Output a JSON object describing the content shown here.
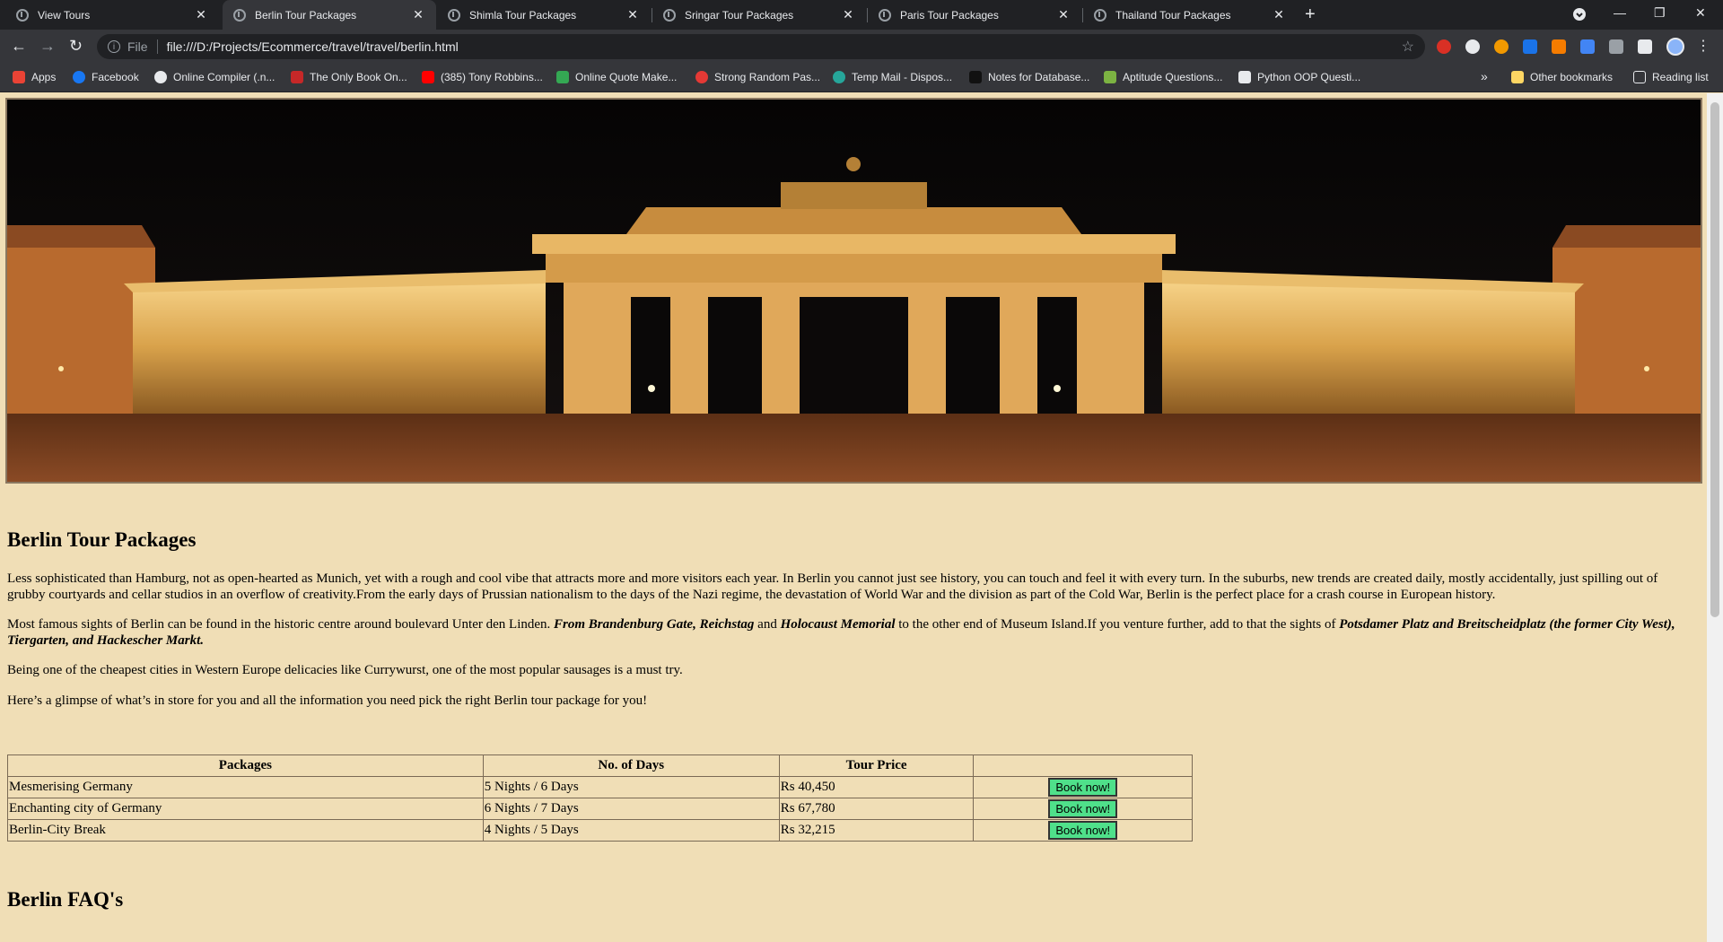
{
  "browser": {
    "tabs": [
      {
        "title": "View Tours",
        "active": false
      },
      {
        "title": "Berlin Tour Packages",
        "active": true
      },
      {
        "title": "Shimla Tour Packages",
        "active": false
      },
      {
        "title": "Sringar Tour Packages",
        "active": false
      },
      {
        "title": "Paris Tour Packages",
        "active": false
      },
      {
        "title": "Thailand Tour Packages",
        "active": false
      }
    ],
    "address": {
      "chip": "File",
      "url": "file:///D:/Projects/Ecommerce/travel/travel/berlin.html"
    },
    "bookmarks": [
      {
        "label": "Apps",
        "icon": "apps-grid-icon",
        "color": "#ea4335"
      },
      {
        "label": "Facebook",
        "icon": "facebook-icon",
        "color": "#1877f2"
      },
      {
        "label": "Online Compiler (.n...",
        "icon": "compiler-icon",
        "color": "#e8eaed"
      },
      {
        "label": "The Only Book On...",
        "icon": "book-icon",
        "color": "#c62828"
      },
      {
        "label": "(385) Tony Robbins...",
        "icon": "youtube-icon",
        "color": "#ff0000"
      },
      {
        "label": "Online Quote Make...",
        "icon": "quote-icon",
        "color": "#34a853"
      },
      {
        "label": "Strong Random Pas...",
        "icon": "password-icon",
        "color": "#e53935"
      },
      {
        "label": "Temp Mail - Dispos...",
        "icon": "tempmail-icon",
        "color": "#26a69a"
      },
      {
        "label": "Notes for Database...",
        "icon": "notes-icon",
        "color": "#111111"
      },
      {
        "label": "Aptitude Questions...",
        "icon": "aptitude-icon",
        "color": "#7cb342"
      },
      {
        "label": "Python OOP Questi...",
        "icon": "python-icon",
        "color": "#e8eaed"
      }
    ],
    "overflow": "»",
    "other_bookmarks": "Other bookmarks",
    "reading_list": "Reading list"
  },
  "page": {
    "title": "Berlin Tour Packages",
    "p1": "Less sophisticated than Hamburg, not as open-hearted as Munich, yet with a rough and cool vibe that attracts more and more visitors each year. In Berlin you cannot just see history, you can touch and feel it with every turn. In the suburbs, new trends are created daily, mostly accidentally, just spilling out of grubby courtyards and cellar studios in an overflow of creativity.From the early days of Prussian nationalism to the days of the Nazi regime, the devastation of World War and the division as part of the Cold War, Berlin is the perfect place for a crash course in European history.",
    "p2_a": "Most famous sights of Berlin can be found in the historic centre around boulevard Unter den Linden. ",
    "p2_b": "From Brandenburg Gate, Reichstag",
    "p2_c": " and ",
    "p2_d": "Holocaust Memorial",
    "p2_e": " to the other end of Museum Island.If you venture further, add to that the sights of ",
    "p2_f": "Potsdamer Platz and Breitscheidplatz (the former City West), Tiergarten, and Hackescher Markt.",
    "p3": "Being one of the cheapest cities in Western Europe delicacies like Currywurst, one of the most popular sausages is a must try.",
    "p4": "Here’s a glimpse of what’s in store for you and all the information you need pick the right Berlin tour package for you!",
    "table": {
      "headers": [
        "Packages",
        "No. of Days",
        "Tour Price",
        ""
      ],
      "rows": [
        {
          "package": "Mesmerising Germany",
          "days": "5 Nights / 6 Days",
          "price": "Rs 40,450",
          "action": "Book now!"
        },
        {
          "package": "Enchanting city of Germany",
          "days": "6 Nights / 7 Days",
          "price": "Rs 67,780",
          "action": "Book now!"
        },
        {
          "package": "Berlin-City Break",
          "days": "4 Nights / 5 Days",
          "price": "Rs 32,215",
          "action": "Book now!"
        }
      ]
    },
    "faq_title": "Berlin FAQ's"
  },
  "colors": {
    "page_background": "#f0deb6",
    "book_button": "#4fe08a",
    "chrome_dark": "#202124",
    "chrome_toolbar": "#35363a"
  }
}
